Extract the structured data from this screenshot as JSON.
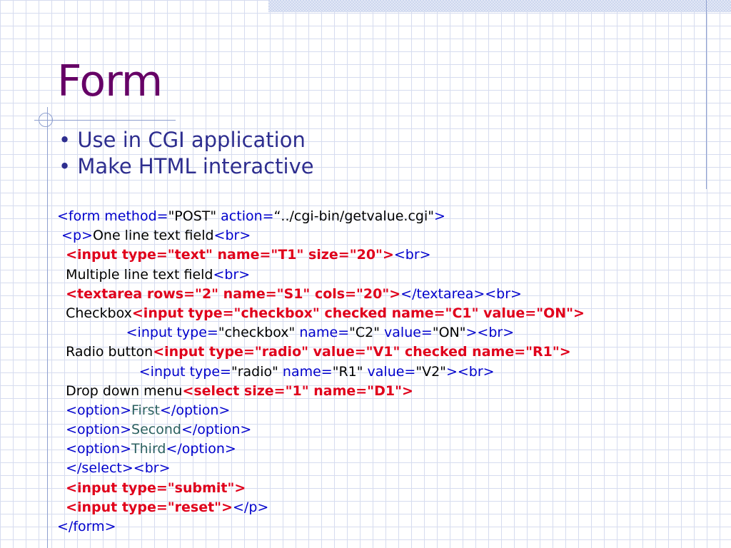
{
  "slide": {
    "title": "Form",
    "bullets": [
      "• Use in CGI application",
      "• Make HTML interactive"
    ]
  },
  "code": [
    {
      "indent": "",
      "segments": [
        {
          "text": "<form method=",
          "style": "tag"
        },
        {
          "text": "\"POST\"",
          "style": "plain"
        },
        {
          "text": " action=",
          "style": "tag"
        },
        {
          "text": "“../cgi-bin/getvalue.cgi\"",
          "style": "plain"
        },
        {
          "text": ">",
          "style": "tag"
        }
      ]
    },
    {
      "indent": " ",
      "segments": [
        {
          "text": "<p>",
          "style": "tag"
        },
        {
          "text": "One line text field",
          "style": "plain"
        },
        {
          "text": "<br>",
          "style": "tag"
        }
      ]
    },
    {
      "indent": "  ",
      "segments": [
        {
          "text": "<input type=\"text\" name=\"T1\" size=\"20\">",
          "style": "bold"
        },
        {
          "text": "<br>",
          "style": "tag"
        }
      ]
    },
    {
      "indent": "  ",
      "segments": [
        {
          "text": "Multiple line text field",
          "style": "plain"
        },
        {
          "text": "<br>",
          "style": "tag"
        }
      ]
    },
    {
      "indent": "  ",
      "segments": [
        {
          "text": "<textarea rows=\"2\" name=\"S1\" cols=\"20\">",
          "style": "bold"
        },
        {
          "text": "</textarea><br>",
          "style": "tag"
        }
      ]
    },
    {
      "indent": "  ",
      "segments": [
        {
          "text": "Checkbox",
          "style": "plain"
        },
        {
          "text": "<input type=\"checkbox\" checked name=\"C1\" value=\"ON\">",
          "style": "bold"
        }
      ]
    },
    {
      "indent": "                ",
      "segments": [
        {
          "text": "<input type=",
          "style": "tag"
        },
        {
          "text": "\"checkbox\"",
          "style": "plain"
        },
        {
          "text": " name=",
          "style": "tag"
        },
        {
          "text": "\"C2\"",
          "style": "plain"
        },
        {
          "text": " value=",
          "style": "tag"
        },
        {
          "text": "\"ON\"",
          "style": "plain"
        },
        {
          "text": "><br>",
          "style": "tag"
        }
      ]
    },
    {
      "indent": "  ",
      "segments": [
        {
          "text": "Radio button",
          "style": "plain"
        },
        {
          "text": "<input type=\"radio\" value=\"V1\" checked name=\"R1\">",
          "style": "bold"
        }
      ]
    },
    {
      "indent": "                   ",
      "segments": [
        {
          "text": "<input type=",
          "style": "tag"
        },
        {
          "text": "\"radio\"",
          "style": "plain"
        },
        {
          "text": " name=",
          "style": "tag"
        },
        {
          "text": "\"R1\"",
          "style": "plain"
        },
        {
          "text": " value=",
          "style": "tag"
        },
        {
          "text": "\"V2\"",
          "style": "plain"
        },
        {
          "text": "><br>",
          "style": "tag"
        }
      ]
    },
    {
      "indent": "  ",
      "segments": [
        {
          "text": "Drop down menu",
          "style": "plain"
        },
        {
          "text": "<select size=\"1\" name=\"D1\">",
          "style": "bold"
        }
      ]
    },
    {
      "indent": "  ",
      "segments": [
        {
          "text": "<option>",
          "style": "tag"
        },
        {
          "text": "First",
          "style": "option"
        },
        {
          "text": "</option>",
          "style": "tag"
        }
      ]
    },
    {
      "indent": "  ",
      "segments": [
        {
          "text": "<option>",
          "style": "tag"
        },
        {
          "text": "Second",
          "style": "option"
        },
        {
          "text": "</option>",
          "style": "tag"
        }
      ]
    },
    {
      "indent": "  ",
      "segments": [
        {
          "text": "<option>",
          "style": "tag"
        },
        {
          "text": "Third",
          "style": "option"
        },
        {
          "text": "</option>",
          "style": "tag"
        }
      ]
    },
    {
      "indent": "  ",
      "segments": [
        {
          "text": "</select><br>",
          "style": "tag"
        }
      ]
    },
    {
      "indent": "  ",
      "segments": [
        {
          "text": "<input type=\"submit\">",
          "style": "bold"
        }
      ]
    },
    {
      "indent": "  ",
      "segments": [
        {
          "text": "<input type=\"reset\">",
          "style": "bold"
        },
        {
          "text": "</p>",
          "style": "tag"
        }
      ]
    },
    {
      "indent": "",
      "segments": [
        {
          "text": "</form>",
          "style": "tag"
        }
      ]
    }
  ],
  "colors": {
    "title": "#660066",
    "bullet_text": "#2e2e8f",
    "tag": "#0000cc",
    "bold_code": "#e0001b",
    "plain": "#000000",
    "option_text": "#2b6060",
    "grid": "#d6dcef",
    "decor_line": "#8fa0cf"
  }
}
